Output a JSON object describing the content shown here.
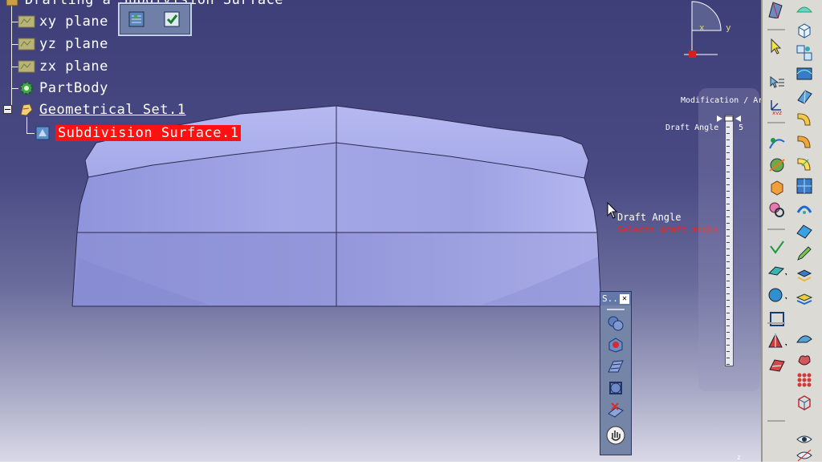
{
  "tree": {
    "root_label": "Drafting a Subdivision Surface",
    "items": [
      {
        "label": "xy plane"
      },
      {
        "label": "yz plane"
      },
      {
        "label": "zx plane"
      },
      {
        "label": "PartBody"
      },
      {
        "label": "Geometrical Set.1"
      },
      {
        "label": "Subdivision Surface.1"
      }
    ]
  },
  "compass": {
    "x_label": "x",
    "y_label": "y"
  },
  "prompt": {
    "title": "Draft Angle",
    "hint": "Selects draft angle"
  },
  "s_toolbar": {
    "title": "S.."
  },
  "modification": {
    "title": "Modification / Ar",
    "label": "Draft Angle",
    "value": "5"
  },
  "viewport_corner": "z",
  "colors": {
    "selection": "#ff1111",
    "surface": "#9ea3e3",
    "background": "#46477f"
  }
}
